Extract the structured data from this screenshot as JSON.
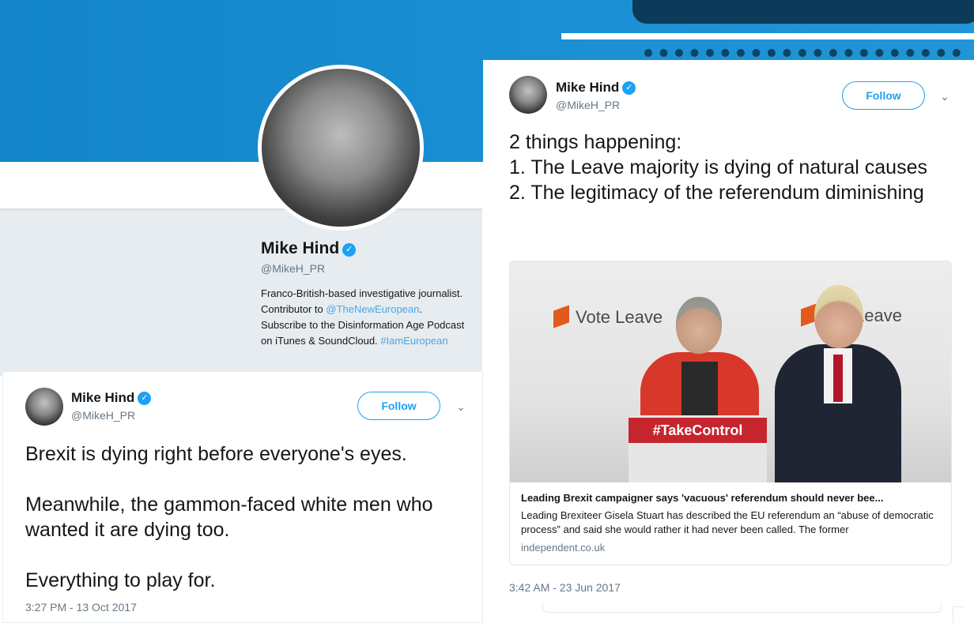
{
  "profile": {
    "name": "Mike Hind",
    "handle": "@MikeH_PR",
    "bio_1": "Franco-British-based investigative journalist. Contributor to ",
    "bio_mention": "@TheNewEuropean",
    "bio_2": ". Subscribe to the Disinformation Age Podcast on iTunes & SoundCloud. ",
    "bio_hashtag": "#IamEuropean"
  },
  "tweet_left": {
    "name": "Mike Hind",
    "handle": "@MikeH_PR",
    "follow_label": "Follow",
    "lines": [
      "Brexit is dying right before everyone's eyes.",
      "Meanwhile, the gammon-faced white men who wanted it are dying too.",
      "Everything to play for."
    ],
    "timestamp": "3:27 PM - 13 Oct 2017"
  },
  "tweet_right": {
    "name": "Mike Hind",
    "handle": "@MikeH_PR",
    "follow_label": "Follow",
    "lines": [
      "2 things happening:",
      "1. The Leave majority is dying of natural causes",
      "2. The legitimacy of the referendum diminishing"
    ],
    "link_card": {
      "photo_sign_left": "Vote Leave",
      "photo_sign_right": "Leave",
      "podium_text": "#TakeControl",
      "title": "Leading Brexit campaigner says 'vacuous' referendum should never bee...",
      "description": "Leading Brexiteer Gisela Stuart has described the EU referendum an “abuse of democratic process” and said she would rather it had never been called. The former",
      "domain": "independent.co.uk"
    },
    "timestamp": "3:42 AM - 23 Jun 2017"
  },
  "icons": {
    "verified": "verified-badge-icon",
    "menu": "chevron-down-icon"
  },
  "colors": {
    "banner": "#1a8fd3",
    "accent": "#1da1f2",
    "link": "#4aa6e8",
    "muted": "#657786",
    "brexit_red": "#c7252e",
    "vote_leave_orange": "#e05a1d"
  }
}
